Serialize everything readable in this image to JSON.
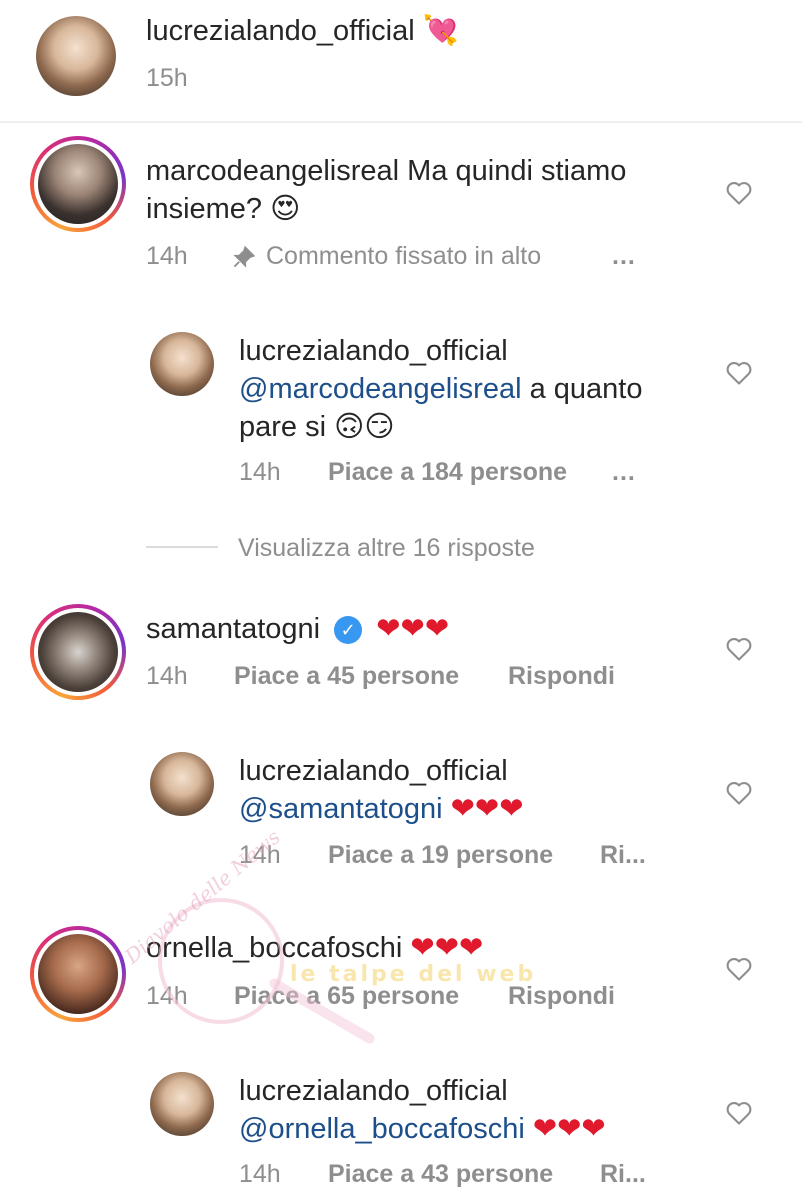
{
  "caption": {
    "username": "lucrezialando_official",
    "emoji": "💘",
    "time": "15h"
  },
  "comments": [
    {
      "username": "marcodeangelisreal",
      "text_line1": "Ma quindi stiamo",
      "text_line2": "insieme? 😍",
      "time": "14h",
      "pinned_label": "Commento fissato in alto",
      "more": "...",
      "reply": {
        "username": "lucrezialando_official",
        "mention": "@marcodeangelisreal",
        "text_after_mention": " a quanto",
        "text_line3": "pare si 🙃😏",
        "time": "14h",
        "likes": "Piace a 184 persone",
        "more": "..."
      },
      "view_more": "Visualizza altre 16 risposte"
    },
    {
      "username": "samantatogni",
      "text": "❤❤❤",
      "time": "14h",
      "likes": "Piace a 45 persone",
      "reply_label": "Rispondi",
      "reply": {
        "username": "lucrezialando_official",
        "mention": "@samantatogni",
        "text": " ❤❤❤",
        "time": "14h",
        "likes": "Piace a 19 persone",
        "reply_label": "Ri..."
      }
    },
    {
      "username": "ornella_boccafoschi",
      "text": "❤❤❤",
      "time": "14h",
      "likes": "Piace a 65 persone",
      "reply_label": "Rispondi",
      "reply": {
        "username": "lucrezialando_official",
        "mention": "@ornella_boccafoschi",
        "text": " ❤❤❤",
        "time": "14h",
        "likes": "Piace a 43 persone",
        "reply_label": "Ri..."
      }
    }
  ],
  "watermark": {
    "text1": "Diavolo delle News",
    "text2": "le talpe del web"
  },
  "colors": {
    "mention": "#1d4f8a",
    "meta": "#8e8e8e",
    "heart": "#e0192d"
  }
}
